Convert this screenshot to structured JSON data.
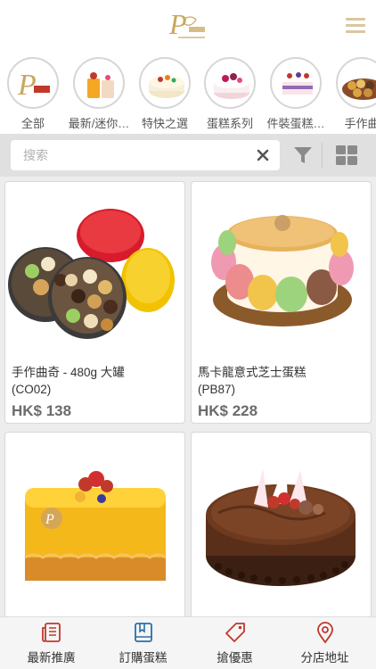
{
  "categories": [
    {
      "label": "全部",
      "icon": "brand-logo-icon"
    },
    {
      "label": "最新/迷你…",
      "icon": "mini-cake-icon"
    },
    {
      "label": "特快之選",
      "icon": "fruit-cake-icon"
    },
    {
      "label": "蛋糕系列",
      "icon": "berry-cake-icon"
    },
    {
      "label": "件裝蛋糕…",
      "icon": "slice-cake-icon"
    },
    {
      "label": "手作曲",
      "icon": "cookie-icon"
    }
  ],
  "search": {
    "placeholder": "搜索",
    "value": ""
  },
  "products": [
    {
      "name": "手作曲奇 - 480g 大罐",
      "code": "(CO02)",
      "price": "HK$ 138"
    },
    {
      "name": "馬卡龍意式芝士蛋糕",
      "code": "(PB87)",
      "price": "HK$ 228"
    },
    {
      "name": "",
      "code": "",
      "price": ""
    },
    {
      "name": "",
      "code": "",
      "price": ""
    }
  ],
  "tabs": [
    {
      "label": "最新推廣",
      "icon": "news-icon",
      "color": "#c0392b"
    },
    {
      "label": "訂購蛋糕",
      "icon": "book-icon",
      "color": "#2b6fa8"
    },
    {
      "label": "搶優惠",
      "icon": "tag-icon",
      "color": "#c0392b"
    },
    {
      "label": "分店地址",
      "icon": "location-pin-icon",
      "color": "#c0392b"
    }
  ],
  "colors": {
    "accent": "#d9c7a0",
    "tab_red": "#c0392b",
    "tab_blue": "#2b6fa8",
    "price": "#6b6b6b"
  }
}
